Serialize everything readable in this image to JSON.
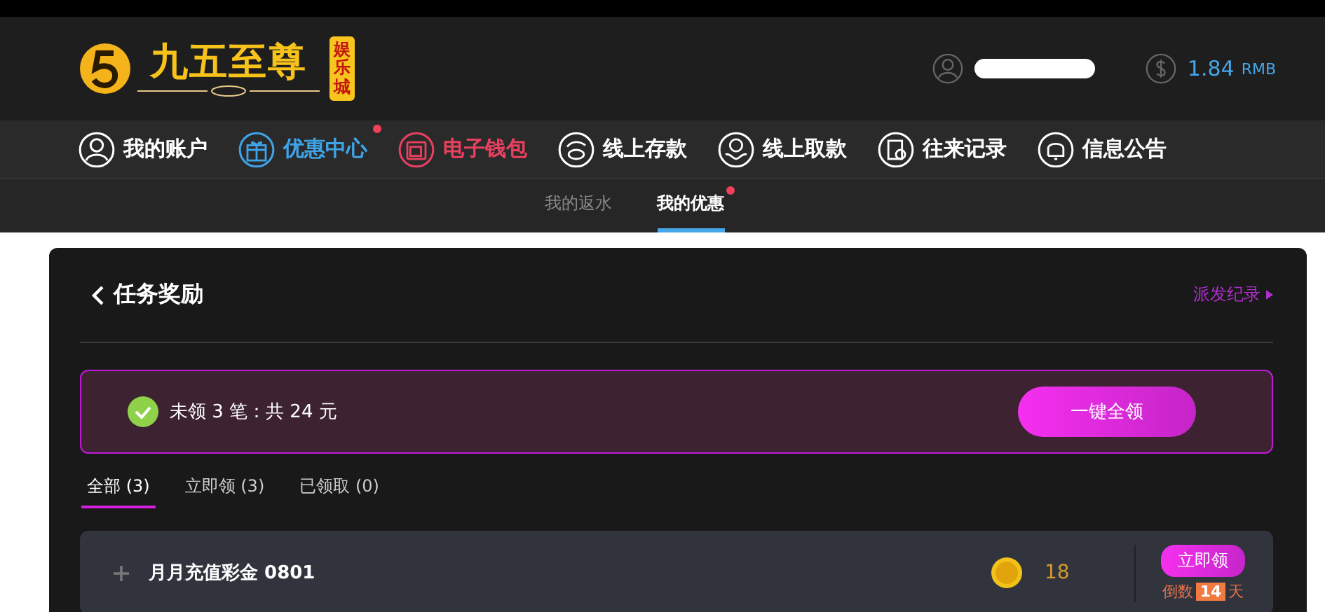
{
  "header": {
    "logo_text": "九五至尊",
    "logo_badge": "娱乐城",
    "balance": "1.84",
    "currency": "RMB"
  },
  "nav": [
    {
      "label": "我的账户",
      "kind": "user",
      "color": "#ffffff",
      "notify": false
    },
    {
      "label": "优惠中心",
      "kind": "gift",
      "color": "#3fa3e8",
      "notify": true
    },
    {
      "label": "电子钱包",
      "kind": "wallet",
      "color": "#e8405f",
      "notify": false
    },
    {
      "label": "线上存款",
      "kind": "deposit",
      "color": "#ffffff",
      "notify": false
    },
    {
      "label": "线上取款",
      "kind": "withdraw",
      "color": "#ffffff",
      "notify": false
    },
    {
      "label": "往来记录",
      "kind": "record",
      "color": "#ffffff",
      "notify": false
    },
    {
      "label": "信息公告",
      "kind": "bell",
      "color": "#ffffff",
      "notify": false
    }
  ],
  "subtabs": [
    {
      "label": "我的返水",
      "selected": false,
      "notify": false
    },
    {
      "label": "我的优惠",
      "selected": true,
      "notify": true
    }
  ],
  "panel": {
    "title": "任务奖励",
    "history_link": "派发纪录",
    "summary": "未领 3 笔：共 24 元",
    "claim_all": "一键全领",
    "filters": [
      {
        "label": "全部 (3)",
        "selected": true
      },
      {
        "label": "立即领 (3)",
        "selected": false
      },
      {
        "label": "已领取 (0)",
        "selected": false
      }
    ],
    "rewards": [
      {
        "name": "月月充值彩金 0801",
        "amount": "18",
        "action": "立即领",
        "countdown_prefix": "倒数",
        "countdown_days": "14",
        "countdown_unit": "天"
      }
    ]
  }
}
